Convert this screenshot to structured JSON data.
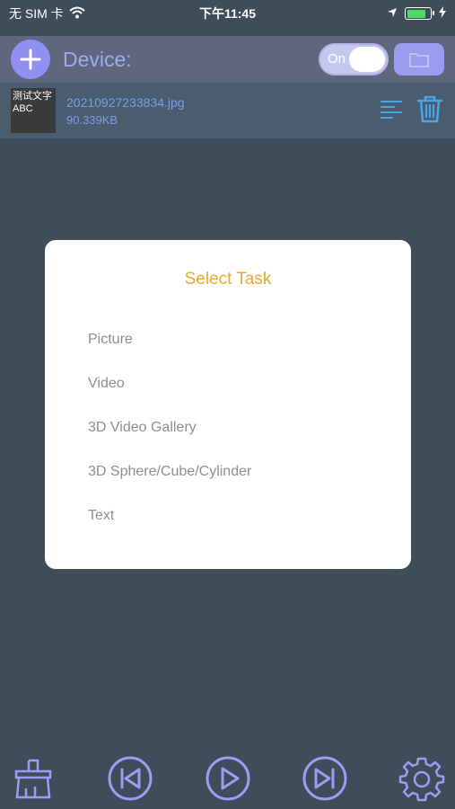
{
  "status_bar": {
    "carrier": "无 SIM 卡",
    "time": "下午11:45",
    "battery_level": 0.8
  },
  "toolbar": {
    "device_label": "Device:",
    "toggle_text": "On",
    "toggle_state": "on"
  },
  "file": {
    "thumbnail_line1": "测试文字",
    "thumbnail_line2": "ABC",
    "name": "20210927233834.jpg",
    "size": "90.339KB"
  },
  "dialog": {
    "title": "Select Task",
    "tasks": [
      "Picture",
      "Video",
      "3D Video Gallery",
      "3D Sphere/Cube/Cylinder",
      "Text"
    ]
  },
  "colors": {
    "background": "#3f4c59",
    "accent_purple": "#9090f0",
    "title_orange": "#f5a623",
    "file_text_blue": "#7d9bea",
    "icon_blue": "#49a6e6"
  },
  "bottom_bar": {
    "icons": [
      "clean-brush-icon",
      "previous-icon",
      "play-icon",
      "next-icon",
      "settings-icon"
    ]
  }
}
